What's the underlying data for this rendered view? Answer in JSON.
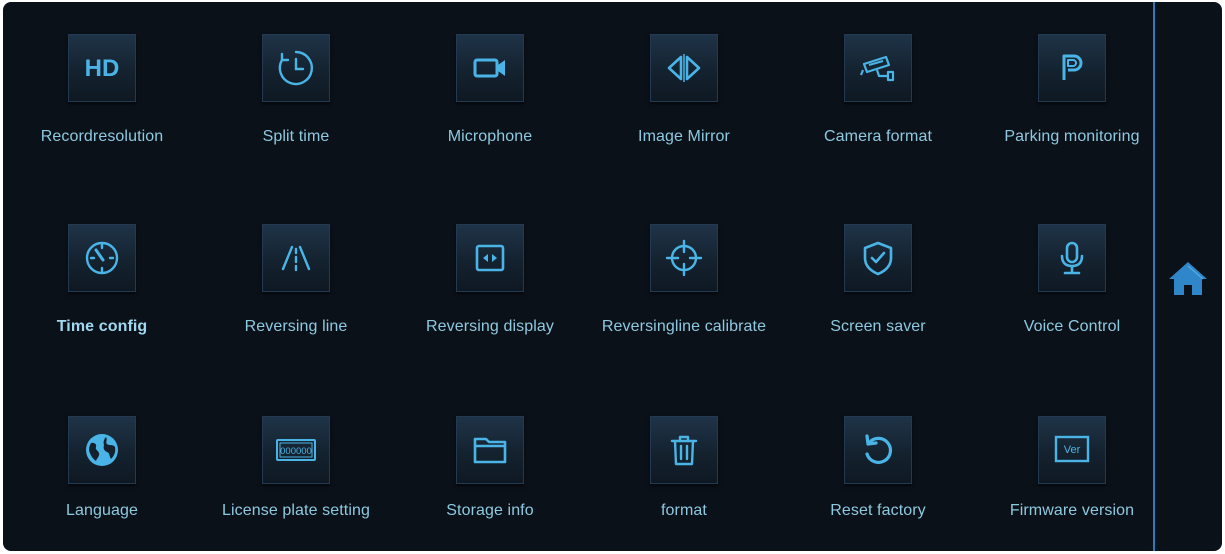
{
  "accent_color": "#4ab4e6",
  "active_color": "#9fd8ef",
  "home_color": "#2f86c8",
  "rows": [
    [
      {
        "label": "Recordresolution",
        "icon": "hd-icon"
      },
      {
        "label": "Split time",
        "icon": "clock-icon"
      },
      {
        "label": "Microphone",
        "icon": "video-camera-icon"
      },
      {
        "label": "Image Mirror",
        "icon": "mirror-icon"
      },
      {
        "label": "Camera format",
        "icon": "security-camera-icon"
      },
      {
        "label": "Parking monitoring",
        "icon": "parking-icon"
      }
    ],
    [
      {
        "label": "Time config",
        "icon": "gauge-icon",
        "active": true
      },
      {
        "label": "Reversing line",
        "icon": "road-lines-icon"
      },
      {
        "label": "Reversing display",
        "icon": "screen-arrows-icon"
      },
      {
        "label": "Reversingline calibrate",
        "icon": "crosshair-icon"
      },
      {
        "label": "Screen saver",
        "icon": "shield-check-icon"
      },
      {
        "label": "Voice Control",
        "icon": "microphone-icon"
      }
    ],
    [
      {
        "label": "Language",
        "icon": "globe-icon"
      },
      {
        "label": "License plate setting",
        "icon": "license-plate-icon"
      },
      {
        "label": "Storage info",
        "icon": "folder-icon"
      },
      {
        "label": "format",
        "icon": "trash-icon"
      },
      {
        "label": "Reset factory",
        "icon": "reset-icon"
      },
      {
        "label": "Firmware version",
        "icon": "version-icon"
      }
    ]
  ],
  "icon_text": {
    "hd": "HD",
    "plate": "000000",
    "version": "Ver"
  },
  "home": {
    "icon": "home-icon"
  }
}
